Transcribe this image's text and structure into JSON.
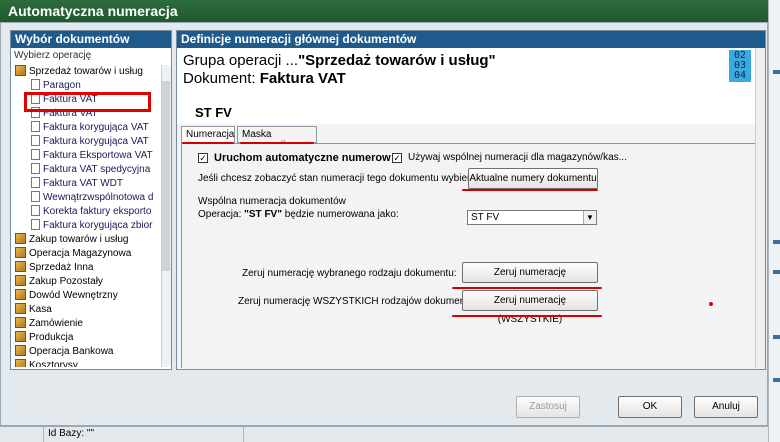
{
  "window": {
    "title": "Automatyczna numeracja"
  },
  "left_panel": {
    "header": "Wybór dokumentów",
    "subheader": "Wybierz operację",
    "tree": [
      {
        "label": "Sprzedaż towarów i usług",
        "icon": "folder-icon",
        "level": 0
      },
      {
        "label": "Paragon",
        "icon": "document-icon",
        "level": 1
      },
      {
        "label": "Faktura VAT",
        "icon": "document-icon",
        "level": 1
      },
      {
        "label": "Faktura VAT",
        "icon": "document-icon",
        "level": 1
      },
      {
        "label": "Faktura korygująca VAT",
        "icon": "document-icon",
        "level": 1
      },
      {
        "label": "Faktura korygująca VAT",
        "icon": "document-icon",
        "level": 1
      },
      {
        "label": "Faktura Eksportowa VAT",
        "icon": "document-icon",
        "level": 1
      },
      {
        "label": "Faktura VAT spedycyjna",
        "icon": "document-icon",
        "level": 1
      },
      {
        "label": "Faktura VAT WDT",
        "icon": "document-icon",
        "level": 1
      },
      {
        "label": "Wewnątrzwspólnotowa d",
        "icon": "document-icon",
        "level": 1
      },
      {
        "label": "Korekta faktury eksporto",
        "icon": "document-icon",
        "level": 1
      },
      {
        "label": "Faktura korygująca zbior",
        "icon": "document-icon",
        "level": 1
      },
      {
        "label": "Zakup towarów i usług",
        "icon": "folder-icon",
        "level": 0
      },
      {
        "label": "Operacja Magazynowa",
        "icon": "folder-icon",
        "level": 0
      },
      {
        "label": "Sprzedaż Inna",
        "icon": "folder-icon",
        "level": 0
      },
      {
        "label": "Zakup Pozostały",
        "icon": "folder-icon",
        "level": 0
      },
      {
        "label": "Dowód Wewnętrzny",
        "icon": "folder-icon",
        "level": 0
      },
      {
        "label": "Kasa",
        "icon": "folder-icon",
        "level": 0
      },
      {
        "label": "Zamówienie",
        "icon": "folder-icon",
        "level": 0
      },
      {
        "label": "Produkcja",
        "icon": "folder-icon",
        "level": 0
      },
      {
        "label": "Operacja Bankowa",
        "icon": "folder-icon",
        "level": 0
      },
      {
        "label": "Kosztorysy",
        "icon": "folder-icon",
        "level": 0
      }
    ]
  },
  "right_panel": {
    "header": "Definicje numeracji głównej dokumentów",
    "group_prefix": "Grupa operacji ...",
    "group_name": "\"Sprzedaż towarów i usług\"",
    "document_prefix": "Dokument: ",
    "document_name": "Faktura VAT",
    "calendar_lines": [
      "02",
      "03",
      "04"
    ],
    "code": "ST FV",
    "tabs": [
      "Numeracja",
      "Maska numeracji"
    ],
    "checkbox_auto": {
      "label": "Uruchom automatyczne numerow",
      "checked": true
    },
    "checkbox_shared": {
      "label": "Używaj wspólnej numeracji dla magazynów/kas...",
      "checked": true
    },
    "state_text": "Jeśli chcesz zobaczyć stan numeracji tego dokumentu wybierz...",
    "state_button": "Aktualne numery dokumentu",
    "shared_title": "Wspólna numeracja dokumentów",
    "operation_prefix": "Operacja:",
    "operation_code": "\"ST FV\"",
    "operation_suffix": "będzie numerowana jako:",
    "select_value": "ST FV",
    "reset_text": "Zeruj numerację wybranego rodzaju dokumentu:",
    "reset_button": "Zeruj numerację",
    "reset_all_text": "Zeruj numerację WSZYSTKICH rodzajów dokumentu:",
    "reset_all_button": "Zeruj numerację (WSZYSTKIE)"
  },
  "footer": {
    "apply": "Zastosuj",
    "ok": "OK",
    "cancel": "Anuluj"
  },
  "statusbar": {
    "db": "Id Bazy: \"\""
  },
  "colors": {
    "titlebar": "#1e5a2e",
    "panel_header": "#1f5a8c",
    "annotation_red": "#e00000"
  }
}
